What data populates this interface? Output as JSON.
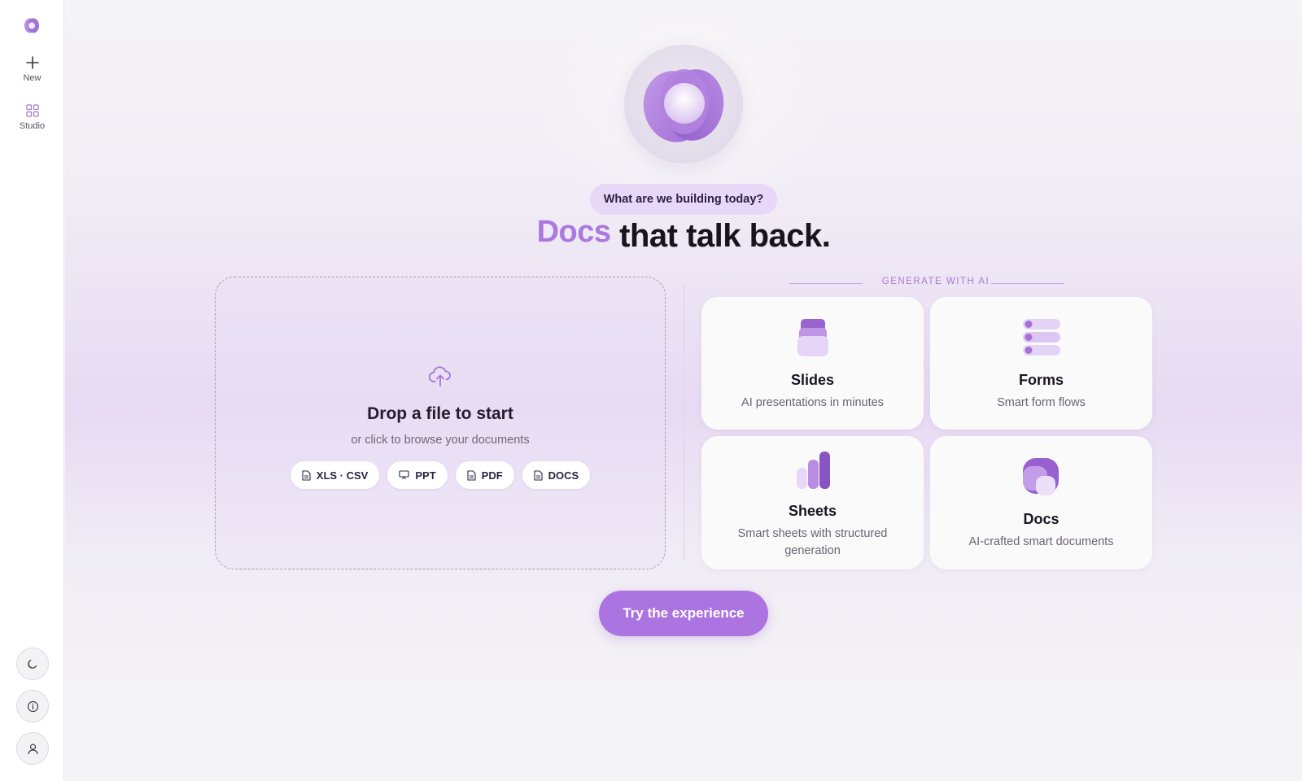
{
  "sidebar": {
    "items": [
      {
        "label": "New",
        "icon": "plus-icon"
      },
      {
        "label": "Studio",
        "icon": "grid-icon"
      }
    ],
    "bottom": [
      {
        "icon": "moon-icon"
      },
      {
        "icon": "info-icon"
      },
      {
        "icon": "user-icon"
      }
    ]
  },
  "hero": {
    "prompt": "What are we building today?",
    "headline_accent": "Docs",
    "headline_rest": " that talk back."
  },
  "dropzone": {
    "title": "Drop a file to start",
    "subtitle": "or click to browse your documents",
    "chips": [
      {
        "label": "XLS · CSV",
        "icon": "file-icon"
      },
      {
        "label": "PPT",
        "icon": "presentation-icon"
      },
      {
        "label": "PDF",
        "icon": "file-icon"
      },
      {
        "label": "DOCS",
        "icon": "file-icon"
      }
    ]
  },
  "generate": {
    "label": "GENERATE WITH AI",
    "cards": [
      {
        "title": "Slides",
        "desc": "AI presentations in minutes",
        "icon": "slides-icon"
      },
      {
        "title": "Forms",
        "desc": "Smart form flows",
        "icon": "forms-icon"
      },
      {
        "title": "Sheets",
        "desc": "Smart sheets with structured generation",
        "icon": "sheets-icon"
      },
      {
        "title": "Docs",
        "desc": "AI-crafted smart documents",
        "icon": "docs-icon"
      }
    ]
  },
  "cta": {
    "label": "Try the experience"
  },
  "colors": {
    "accent": "#ab74e0",
    "accent_light": "#e6d8f6",
    "text": "#19161e"
  }
}
